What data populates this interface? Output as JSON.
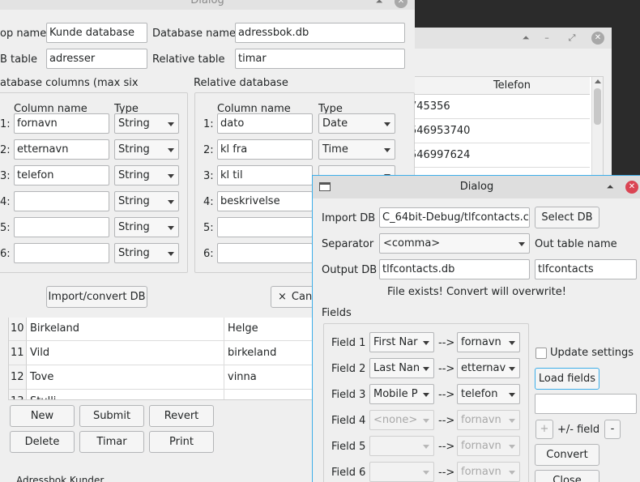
{
  "back_window": {
    "header_telefon": "Telefon",
    "rows": [
      "745356",
      "546953740",
      "546997624"
    ]
  },
  "dialog1": {
    "title": "Dialog",
    "app_name_label": "op name",
    "app_name_value": "Kunde database",
    "db_name_label": "Database name",
    "db_name_value": "adressbok.db",
    "db_table_label": "B table",
    "db_table_value": "adresser",
    "rel_table_label": "Relative table",
    "rel_table_value": "timar",
    "db_columns_label": "atabase columns (max six",
    "rel_db_label": "Relative database",
    "col_name_header": "Column name",
    "type_header": "Type",
    "left_rows": [
      {
        "n": "1:",
        "name": "fornavn",
        "type": "String"
      },
      {
        "n": "2:",
        "name": "etternavn",
        "type": "String"
      },
      {
        "n": "3:",
        "name": "telefon",
        "type": "String"
      },
      {
        "n": "4:",
        "name": "",
        "type": "String"
      },
      {
        "n": "5:",
        "name": "",
        "type": "String"
      },
      {
        "n": "6:",
        "name": "",
        "type": "String"
      }
    ],
    "right_rows": [
      {
        "n": "1:",
        "name": "dato",
        "type": "Date"
      },
      {
        "n": "2:",
        "name": "kl fra",
        "type": "Time"
      },
      {
        "n": "3:",
        "name": "kl til",
        "type": ""
      },
      {
        "n": "4:",
        "name": "beskrivelse",
        "type": ""
      },
      {
        "n": "5:",
        "name": "",
        "type": ""
      },
      {
        "n": "6:",
        "name": "",
        "type": ""
      }
    ],
    "import_button": "Import/convert DB",
    "cancel_button": "Can",
    "cancel_icon": "×"
  },
  "table": {
    "rows": [
      {
        "n": "10",
        "a": "Birkeland",
        "b": "Helge"
      },
      {
        "n": "11",
        "a": "Vild",
        "b": "birkeland"
      },
      {
        "n": "12",
        "a": "Tove",
        "b": "vinna"
      },
      {
        "n": "13",
        "a": "Stulli",
        "b": ""
      }
    ],
    "buttons": {
      "new": "New",
      "submit": "Submit",
      "revert": "Revert",
      "delete": "Delete",
      "timar": "Timar",
      "print": "Print"
    },
    "footer_text": "Adressbok Kunder"
  },
  "dialog2": {
    "title": "Dialog",
    "import_db_label": "Import DB",
    "import_db_value": "C_64bit-Debug/tlfcontacts.csv",
    "select_db_button": "Select DB",
    "separator_label": "Separator",
    "separator_value": "<comma>",
    "out_table_label": "Out table name",
    "output_db_label": "Output DB",
    "output_db_value": "tlfcontacts.db",
    "out_table_value": "tlfcontacts",
    "warning": "File exists! Convert will overwrite!",
    "fields_label": "Fields",
    "arrow": "-->",
    "fields": [
      {
        "label": "Field 1",
        "src": "First Nar",
        "dst": "fornavn",
        "src_disabled": false,
        "dst_disabled": false
      },
      {
        "label": "Field 2",
        "src": "Last Nan",
        "dst": "etternav",
        "src_disabled": false,
        "dst_disabled": false
      },
      {
        "label": "Field 3",
        "src": "Mobile P",
        "dst": "telefon",
        "src_disabled": false,
        "dst_disabled": false
      },
      {
        "label": "Field 4",
        "src": "<none>",
        "dst": "fornavn",
        "src_disabled": true,
        "dst_disabled": true
      },
      {
        "label": "Field 5",
        "src": "",
        "dst": "fornavn",
        "src_disabled": true,
        "dst_disabled": true
      },
      {
        "label": "Field 6",
        "src": "",
        "dst": "fornavn",
        "src_disabled": true,
        "dst_disabled": true
      }
    ],
    "update_settings": "Update settings",
    "load_fields": "Load fields",
    "plus": "+",
    "field_label": "+/- field",
    "minus": "-",
    "convert": "Convert",
    "close": "Close"
  }
}
